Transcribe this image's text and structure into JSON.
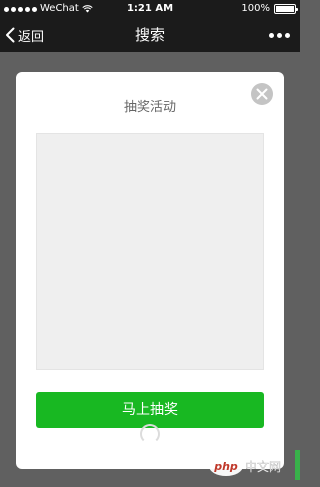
{
  "status_bar": {
    "carrier": "WeChat",
    "time": "1:21 AM",
    "battery": "100%",
    "battery_level": 1.0,
    "icons": [
      "signal-dots-icon",
      "wifi-icon",
      "battery-icon"
    ]
  },
  "nav": {
    "back_label": "返回",
    "title": "搜索",
    "icons": [
      "chevron-left-icon",
      "more-dots-icon"
    ]
  },
  "dialog": {
    "title": "抽奖活动",
    "button_label": "马上抽奖",
    "icons": [
      "close-icon",
      "loading-ring-icon"
    ]
  },
  "watermark": {
    "text": "php中文网"
  },
  "colors": {
    "status_bg": "#1b1b1b",
    "overlay": "#606060",
    "dialog_bg": "#ffffff",
    "prize_area": "#efefef",
    "accent_green": "#18b822",
    "close_bg": "#c4c4c4"
  }
}
